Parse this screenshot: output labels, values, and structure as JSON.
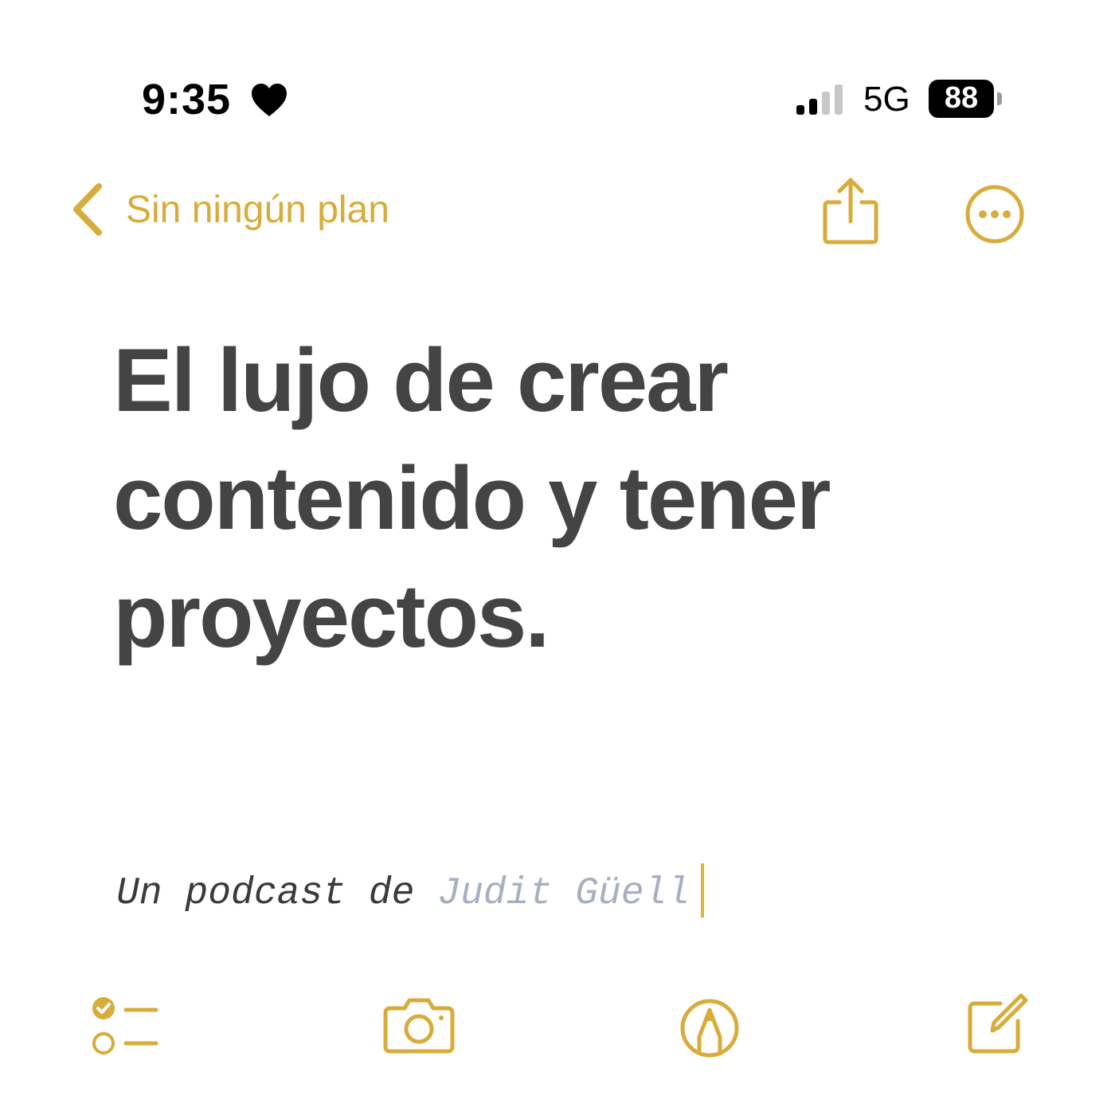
{
  "status_bar": {
    "time": "9:35",
    "network": "5G",
    "battery": "88"
  },
  "nav": {
    "back_label": "Sin ningún plan"
  },
  "note": {
    "title": "El lujo de crear contenido y tener proyectos.",
    "subtitle_prefix": "Un podcast de ",
    "subtitle_name": "Judit Güell"
  },
  "colors": {
    "accent": "#d8ac3a",
    "title_text": "#444444",
    "highlight_text": "#a7afc3"
  },
  "icons": {
    "status": [
      "heart-icon",
      "cellular-signal-icon",
      "battery-icon"
    ],
    "nav": [
      "chevron-left-icon",
      "share-icon",
      "more-icon"
    ],
    "toolbar": [
      "checklist-icon",
      "camera-icon",
      "markup-icon",
      "compose-icon"
    ]
  }
}
